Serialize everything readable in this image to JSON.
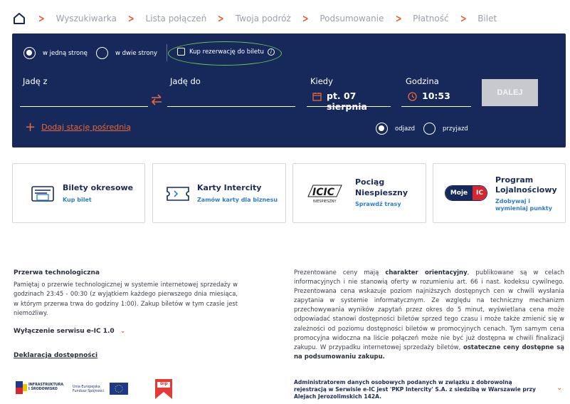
{
  "breadcrumb": {
    "items": [
      "Wyszukiwarka",
      "Lista połączeń",
      "Twoja podróż",
      "Podsumowanie",
      "Płatność",
      "Bilet"
    ]
  },
  "search": {
    "trip_one_way": "w jedną stronę",
    "trip_return": "w dwie strony",
    "reservation_checkbox": "Kup rezerwację do biletu",
    "from_label": "Jadę z",
    "to_label": "Jadę do",
    "date_label": "Kiedy",
    "date_value": "pt. 07 sierpnia",
    "time_label": "Godzina",
    "time_value": "10:53",
    "submit_label": "DALEJ",
    "add_station": "Dodaj stację pośrednią",
    "departure": "odjazd",
    "arrival": "przyjazd"
  },
  "cards": [
    {
      "title": "Bilety okresowe",
      "subtitle": "Kup bilet"
    },
    {
      "title": "Karty Intercity",
      "subtitle": "Zamów karty dla biznesu"
    },
    {
      "title_line1": "Pociąg",
      "title_line2": "Niespieszny",
      "subtitle": "Sprawdź trasy",
      "logo_caption": "NIESPIESZNY"
    },
    {
      "title_line1": "Program",
      "title_line2": "Lojalnościowy",
      "subtitle_line1": "Zdobywaj i",
      "subtitle_line2": "wymieniaj punkty",
      "badge_left": "Moje",
      "badge_right": "IC"
    }
  ],
  "footer": {
    "maintenance_title": "Przerwa technologiczna",
    "maintenance_text": "Pamiętaj o przerwie technologicznej w systemie internetowej sprzedaży w godzinach 23:45 - 00:30 (z wyjątkiem każdego pierwszego dnia miesiąca, w którym przerwa trwa do godziny 1:00). Zakup biletów w tym czasie jest niemożliwy.",
    "service_off": "Wyłączenie serwisu e-IC 1.0",
    "accessibility": "Deklaracja dostępności",
    "prices_p1": "Prezentowane ceny mają ",
    "prices_b1": "charakter orientacyjny",
    "prices_p2": ", publikowane są w celach informacyjnych i nie stanowią oferty w rozumieniu art. 66 i nast. kodeksu cywilnego. Prezentowana cena wskazuje poziom najniższych dostępnych cen w chwili wysłania zapytania w systemie informatycznym.  Ze względu na techniczny mechanizm przechowywania wyników zapytań przez okres do 5 minut, wyświetlana cena może odpowiadać stanowi dostępności biletów sprzed tego czasu i może także zmienić się w zależności od poziomu dostępności biletów w promocyjnych cenach. Tym samym cena promocyjna widoczna na liście połączeń może nie być już dostępna w chwili finalizacji zakupu. W przypadku internetowej sprzedaży biletów, ",
    "prices_b2": "ostateczne ceny dostępne są na podsumowaniu zakupu.",
    "admin": "Administratorem danych osobowych podanych w związku z dobrowolną rejestracją w Serwisie e-IC jest 'PKP Intercity' S.A. z siedzibą w Warszawie przy Alejach Jerozolimskich 142A.",
    "logo_ministry_line1": "INFRASTRUKTURA",
    "logo_ministry_line2": "I ŚRODOWISKO",
    "logo_eu_line1": "Unia Europejska",
    "logo_eu_line2": "Fundusz Spójności",
    "logo_bip": "bip"
  },
  "colors": {
    "navy": "#17295a",
    "accent_orange": "#e65a2a",
    "link_blue": "#2b7cd3",
    "highlight_oval": "#6cc24a"
  }
}
